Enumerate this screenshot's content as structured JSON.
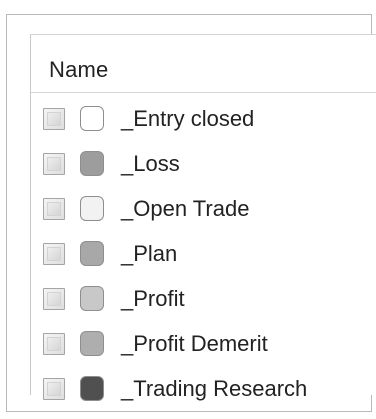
{
  "header": {
    "column_label": "Name"
  },
  "categories": [
    {
      "label": "_Entry closed",
      "color": "#ffffff",
      "checked": false
    },
    {
      "label": "_Loss",
      "color": "#9d9d9d",
      "checked": false
    },
    {
      "label": "_Open Trade",
      "color": "#f2f2f2",
      "checked": false
    },
    {
      "label": "_Plan",
      "color": "#a8a8a8",
      "checked": false
    },
    {
      "label": "_Profit",
      "color": "#c8c8c8",
      "checked": false
    },
    {
      "label": "_Profit Demerit",
      "color": "#aeaeae",
      "checked": false
    },
    {
      "label": "_Trading Research",
      "color": "#505050",
      "checked": false
    }
  ]
}
